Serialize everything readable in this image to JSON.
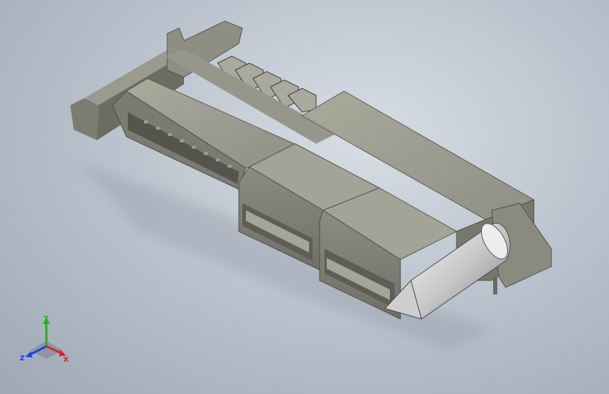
{
  "viewport": {
    "background_top": "#d7dde4",
    "background_bottom": "#9fa9b6"
  },
  "model": {
    "description_icon": "connector-model",
    "body_color": "#8b8b7f",
    "body_dark": "#5f5f55",
    "body_light": "#a7a79a",
    "pin_color": "#d9d9d9"
  },
  "triad": {
    "x_label": "X",
    "y_label": "Y",
    "z_label": "Z",
    "x_color": "#e02020",
    "y_color": "#20b020",
    "z_color": "#2040e0"
  }
}
